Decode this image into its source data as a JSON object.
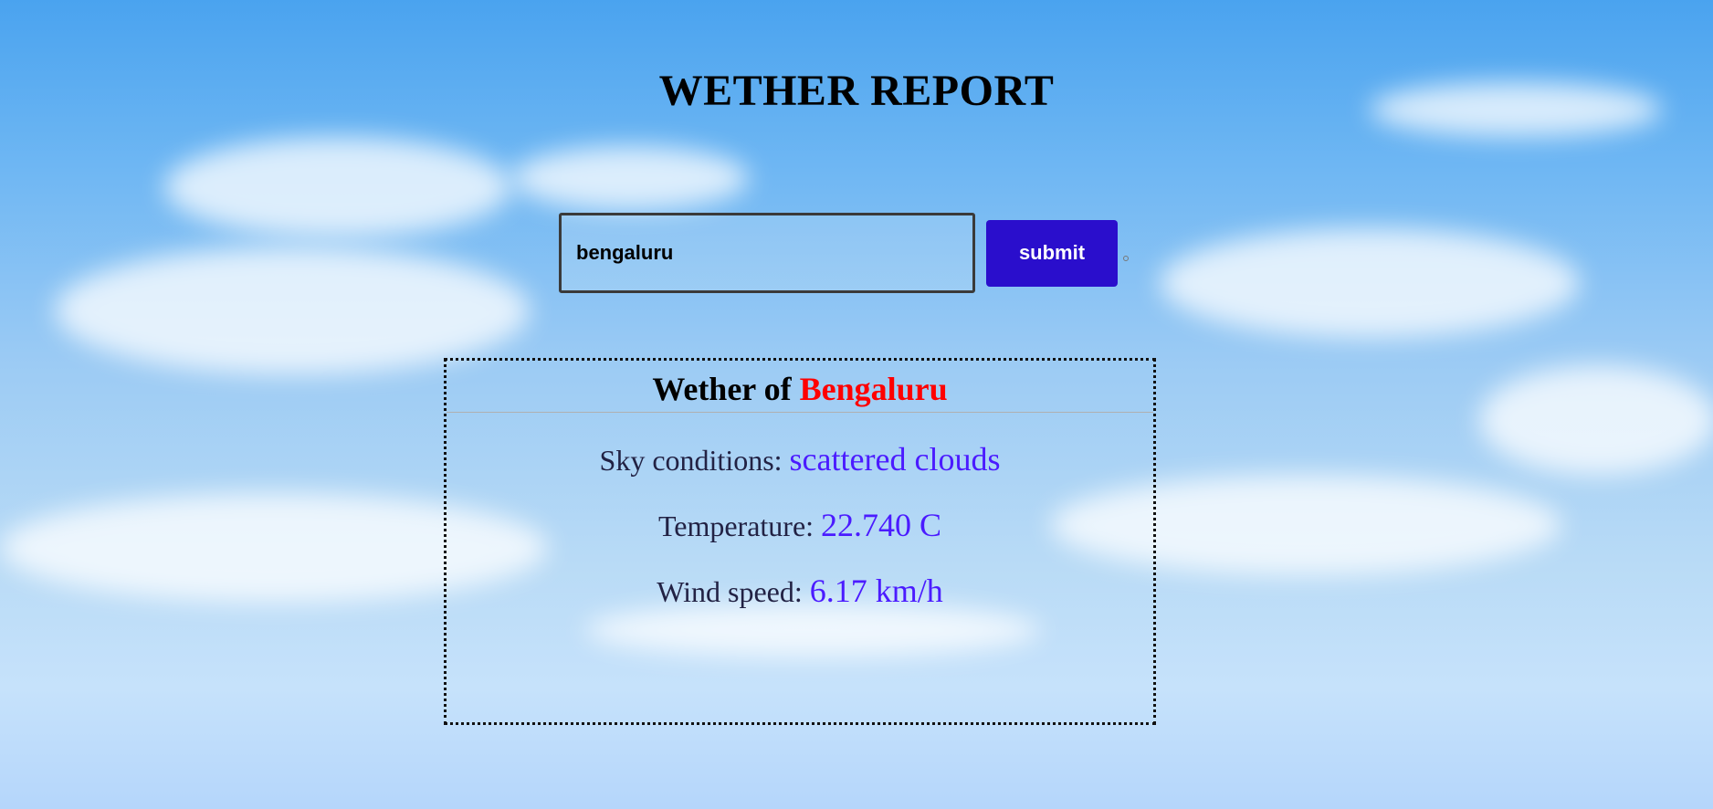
{
  "page": {
    "title": "WETHER REPORT"
  },
  "search": {
    "value": "bengaluru",
    "submit_label": "submit"
  },
  "result": {
    "heading_prefix": "Wether of",
    "city": "Bengaluru",
    "sky_label": "Sky conditions:",
    "sky_value": "scattered clouds",
    "temperature_label": "Temperature:",
    "temperature_value": "22.740 C",
    "wind_label": "Wind speed:",
    "wind_value": "6.17 km/h"
  },
  "colors": {
    "submit_bg": "#2a0ecc",
    "city_name": "#ff0000",
    "value_text": "#4b1bff"
  }
}
